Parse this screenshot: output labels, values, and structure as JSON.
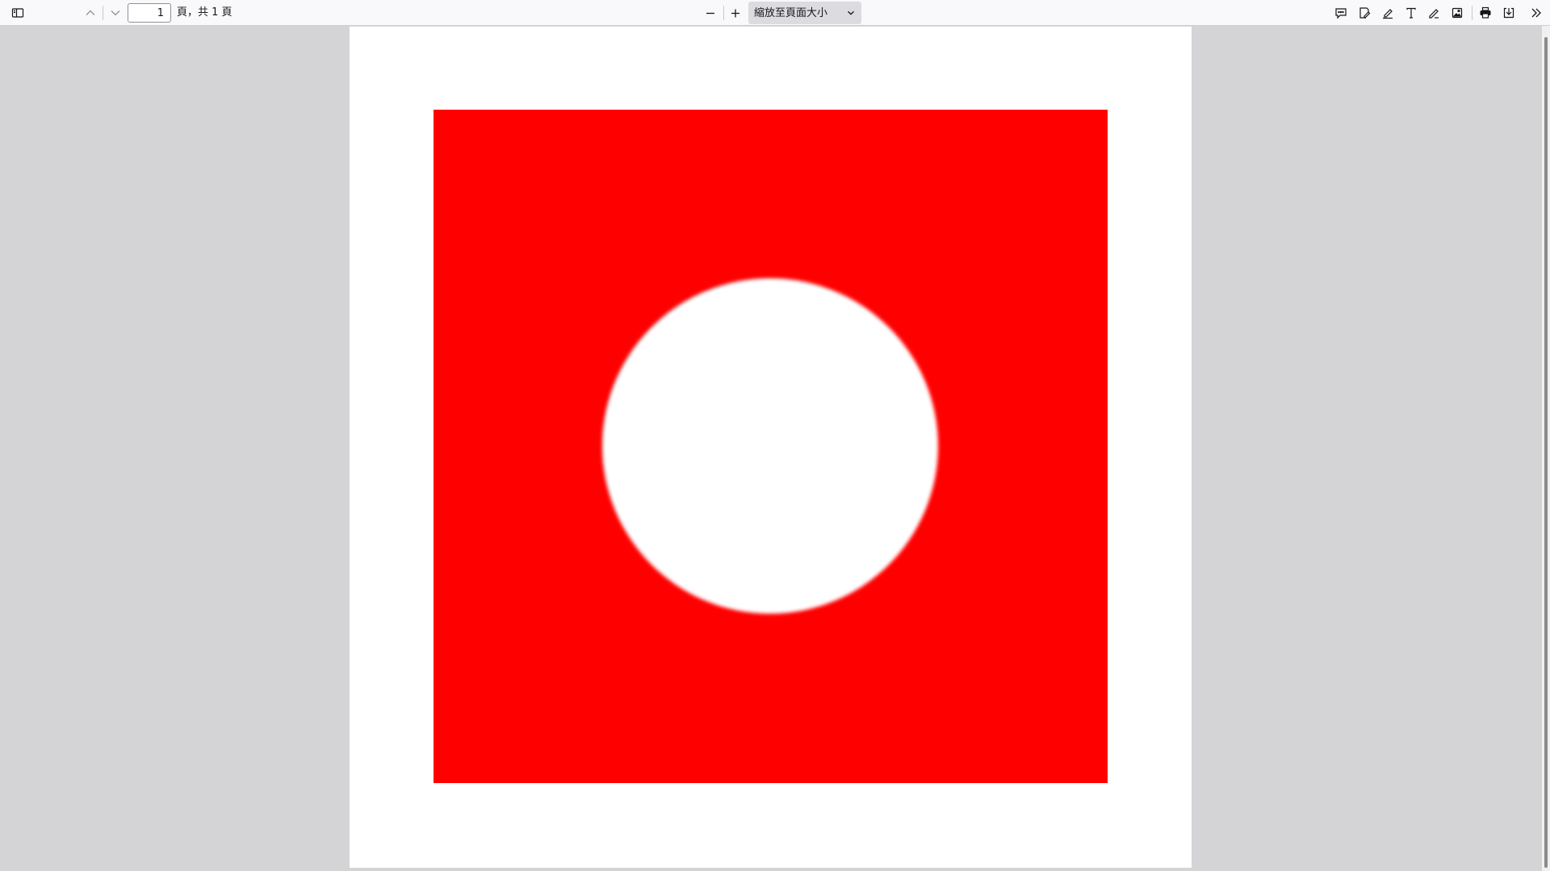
{
  "toolbar": {
    "page_number": "1",
    "page_count_text": "頁，共 1 頁",
    "zoom_label": "縮放至頁面大小"
  },
  "icons": {
    "sidebar": "sidebar-toggle-icon",
    "prev": "chevron-up-icon",
    "next": "chevron-down-icon",
    "zoom_out": "minus-icon",
    "zoom_in": "plus-icon",
    "comment": "comment-icon",
    "signature": "signature-icon",
    "highlight": "highlighter-icon",
    "text": "text-icon",
    "draw": "pen-icon",
    "image": "image-icon",
    "print": "print-icon",
    "save": "save-icon",
    "more": "more-tools-icon"
  },
  "document": {
    "background_color": "#ff0000",
    "circle_color": "#ffffff"
  }
}
